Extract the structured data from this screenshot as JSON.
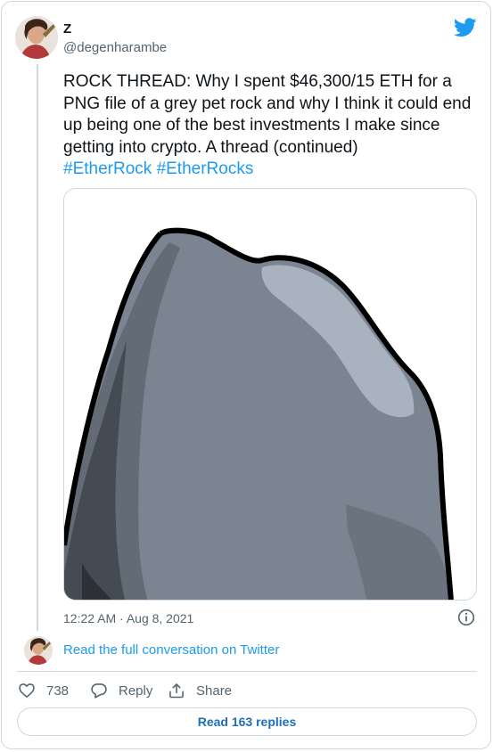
{
  "author": {
    "name": "Z",
    "handle": "@degenharambe"
  },
  "tweet": {
    "text": "ROCK THREAD: Why I spent $46,300/15 ETH for a PNG file of a grey pet rock and why I think it could end up being one of the best investments I make since getting into crypto. A thread (continued)",
    "hashtags": [
      "#EtherRock",
      "#EtherRocks"
    ],
    "timestamp": "12:22 AM · Aug 8, 2021"
  },
  "media": {
    "icon": "grey-pet-rock-image",
    "colors": {
      "rock_main": "#7b8591",
      "rock_shadow": "#555c66",
      "rock_highlight": "#a9b3c0",
      "outline": "#000000"
    }
  },
  "conversation": {
    "link_text": "Read the full conversation on Twitter"
  },
  "actions": {
    "like_count": "738",
    "reply_label": "Reply",
    "share_label": "Share"
  },
  "replies_button": {
    "label": "Read 163 replies"
  },
  "colors": {
    "accent": "#1d9bf0",
    "secondary_text": "#536471",
    "border": "#cfd9de"
  }
}
